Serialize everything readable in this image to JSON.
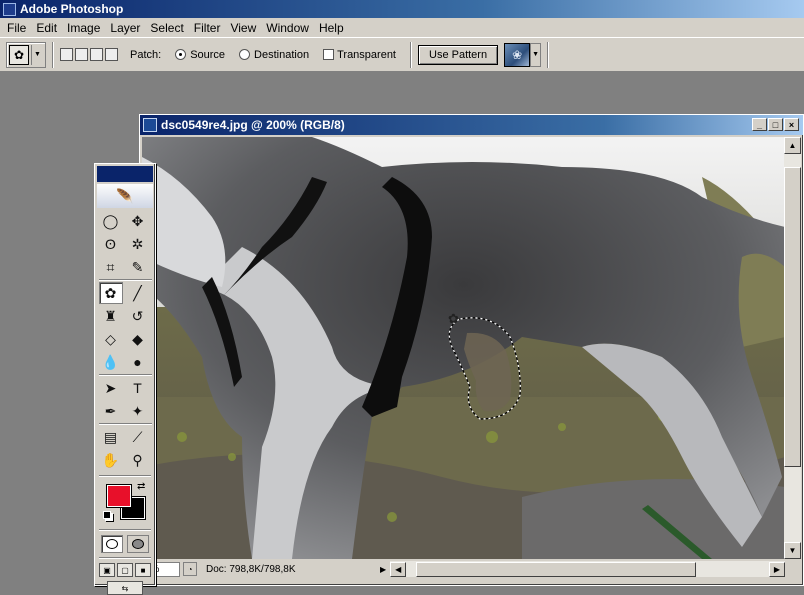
{
  "app": {
    "title": "Adobe Photoshop"
  },
  "menu": [
    "File",
    "Edit",
    "Image",
    "Layer",
    "Select",
    "Filter",
    "View",
    "Window",
    "Help"
  ],
  "options": {
    "patch_label": "Patch:",
    "source_label": "Source",
    "destination_label": "Destination",
    "transparent_label": "Transparent",
    "use_pattern_label": "Use Pattern",
    "selected_mode": "Source"
  },
  "document": {
    "title": "dsc0549re4.jpg @ 200% (RGB/8)",
    "zoom": "0%",
    "doc_info": "Doc: 798,8K/798,8K"
  },
  "window_buttons": {
    "minimize": "_",
    "maximize": "□",
    "close": "×"
  },
  "toolbox": {
    "tools": [
      {
        "name": "elliptical-marquee-tool",
        "glyph": "◯"
      },
      {
        "name": "move-tool",
        "glyph": "✥"
      },
      {
        "name": "lasso-tool",
        "glyph": "ʘ"
      },
      {
        "name": "magic-wand-tool",
        "glyph": "✲"
      },
      {
        "name": "crop-tool",
        "glyph": "⌗"
      },
      {
        "name": "slice-tool",
        "glyph": "✎"
      },
      {
        "name": "patch-tool",
        "glyph": "✿"
      },
      {
        "name": "brush-tool",
        "glyph": "╱"
      },
      {
        "name": "clone-stamp-tool",
        "glyph": "♜"
      },
      {
        "name": "history-brush-tool",
        "glyph": "↺"
      },
      {
        "name": "eraser-tool",
        "glyph": "◇"
      },
      {
        "name": "paint-bucket-tool",
        "glyph": "◆"
      },
      {
        "name": "blur-tool",
        "glyph": "💧"
      },
      {
        "name": "dodge-tool",
        "glyph": "●"
      },
      {
        "name": "path-selection-tool",
        "glyph": "➤"
      },
      {
        "name": "type-tool",
        "glyph": "T"
      },
      {
        "name": "pen-tool",
        "glyph": "✒"
      },
      {
        "name": "custom-shape-tool",
        "glyph": "✦"
      },
      {
        "name": "notes-tool",
        "glyph": "▤"
      },
      {
        "name": "eyedropper-tool",
        "glyph": "⟋"
      },
      {
        "name": "hand-tool",
        "glyph": "✋"
      },
      {
        "name": "zoom-tool",
        "glyph": "⚲"
      }
    ],
    "active_tool": "patch-tool",
    "foreground_color": "#e8102a",
    "background_color": "#000000"
  }
}
